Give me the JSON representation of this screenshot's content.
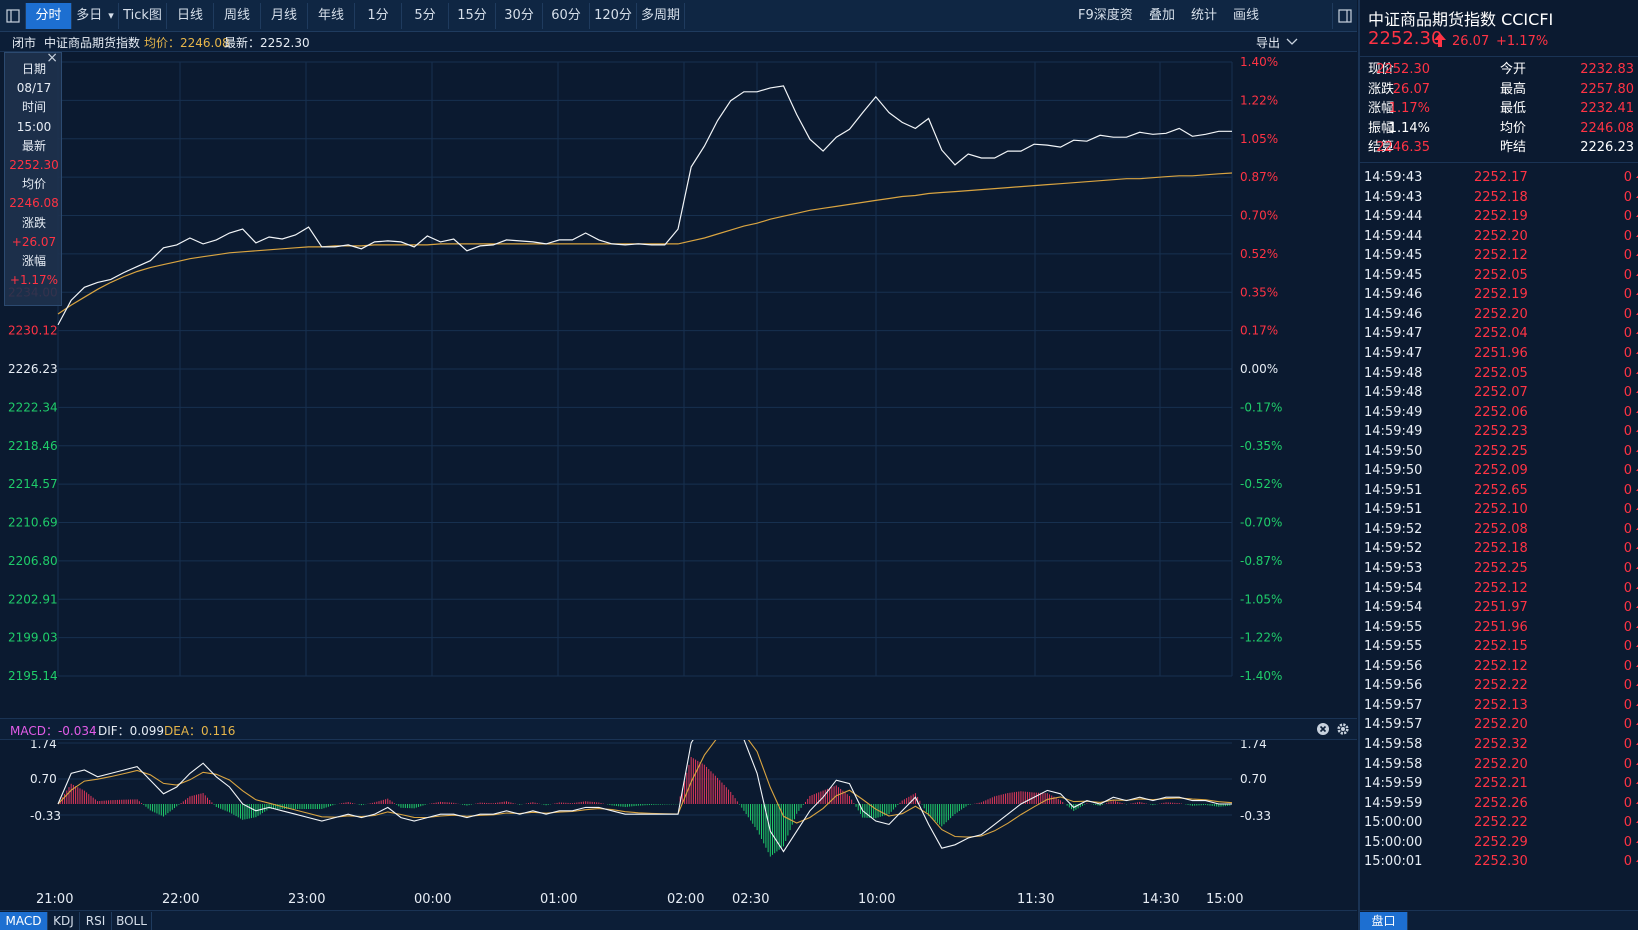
{
  "toolbar": {
    "tabs": [
      "分时",
      "多日",
      "Tick图",
      "日线",
      "周线",
      "月线",
      "年线",
      "1分",
      "5分",
      "15分",
      "30分",
      "60分",
      "120分",
      "多周期"
    ],
    "right": [
      "F9深度资料",
      "叠加",
      "统计",
      "画线"
    ],
    "dropdown_icon": "caret-down-icon"
  },
  "infobar": {
    "status": "闭市",
    "name": "中证商品期货指数",
    "avg_label": "均价：2246.08",
    "last_label": "最新：2252.30",
    "export": "导出"
  },
  "tooltip": {
    "rows": [
      "日期",
      "08/17",
      "时间",
      "15:00",
      "最新",
      "2252.30",
      "均价",
      "2246.08",
      "涨跌",
      "+26.07",
      "涨幅",
      "+1.17%"
    ]
  },
  "axis": {
    "left_prices": [
      "2234.00",
      "2230.12",
      "2226.23",
      "2222.34",
      "2218.46",
      "2214.57",
      "2210.69",
      "2206.80",
      "2202.91",
      "2199.03",
      "2195.14"
    ],
    "right_pcts": [
      "1.40%",
      "1.22%",
      "1.05%",
      "0.87%",
      "0.70%",
      "0.52%",
      "0.35%",
      "0.17%",
      "0.00%",
      "-0.17%",
      "-0.35%",
      "-0.52%",
      "-0.70%",
      "-0.87%",
      "-1.05%",
      "-1.22%",
      "-1.40%"
    ],
    "macd_ticks": [
      "1.74",
      "0.70",
      "-0.33"
    ],
    "time_labels": [
      "21:00",
      "22:00",
      "23:00",
      "00:00",
      "01:00",
      "02:00",
      "02:30",
      "10:00",
      "11:30",
      "14:30",
      "15:00"
    ]
  },
  "macd_bar": {
    "macd": "MACD：-0.034",
    "dif": "DIF：0.099",
    "dea": "DEA：0.116"
  },
  "bottom_tabs": [
    "MACD",
    "KDJ",
    "RSI",
    "BOLL"
  ],
  "quote": {
    "title": "中证商品期货指数 CCICFI",
    "price": "2252.30",
    "change": "26.07",
    "change_pct": "+1.17%",
    "fields": [
      {
        "l": "现价",
        "v": "2252.30",
        "l2": "今开",
        "v2": "2232.83"
      },
      {
        "l": "涨跌",
        "v": "26.07",
        "l2": "最高",
        "v2": "2257.80"
      },
      {
        "l": "涨幅",
        "v": "1.17%",
        "l2": "最低",
        "v2": "2232.41"
      },
      {
        "l": "振幅",
        "v": "1.14%",
        "l2": "均价",
        "v2": "2246.08"
      },
      {
        "l": "结算",
        "v": "2246.35",
        "l2": "昨结",
        "v2": "2226.23"
      }
    ]
  },
  "ticks": [
    [
      "14:59:43",
      "2252.17",
      "0"
    ],
    [
      "14:59:43",
      "2252.18",
      "0"
    ],
    [
      "14:59:44",
      "2252.19",
      "0"
    ],
    [
      "14:59:44",
      "2252.20",
      "0"
    ],
    [
      "14:59:45",
      "2252.12",
      "0"
    ],
    [
      "14:59:45",
      "2252.05",
      "0"
    ],
    [
      "14:59:46",
      "2252.19",
      "0"
    ],
    [
      "14:59:46",
      "2252.20",
      "0"
    ],
    [
      "14:59:47",
      "2252.04",
      "0"
    ],
    [
      "14:59:47",
      "2251.96",
      "0"
    ],
    [
      "14:59:48",
      "2252.05",
      "0"
    ],
    [
      "14:59:48",
      "2252.07",
      "0"
    ],
    [
      "14:59:49",
      "2252.06",
      "0"
    ],
    [
      "14:59:49",
      "2252.23",
      "0"
    ],
    [
      "14:59:50",
      "2252.25",
      "0"
    ],
    [
      "14:59:50",
      "2252.09",
      "0"
    ],
    [
      "14:59:51",
      "2252.65",
      "0"
    ],
    [
      "14:59:51",
      "2252.10",
      "0"
    ],
    [
      "14:59:52",
      "2252.08",
      "0"
    ],
    [
      "14:59:52",
      "2252.18",
      "0"
    ],
    [
      "14:59:53",
      "2252.25",
      "0"
    ],
    [
      "14:59:54",
      "2252.12",
      "0"
    ],
    [
      "14:59:54",
      "2251.97",
      "0"
    ],
    [
      "14:59:55",
      "2251.96",
      "0"
    ],
    [
      "14:59:55",
      "2252.15",
      "0"
    ],
    [
      "14:59:56",
      "2252.12",
      "0"
    ],
    [
      "14:59:56",
      "2252.22",
      "0"
    ],
    [
      "14:59:57",
      "2252.13",
      "0"
    ],
    [
      "14:59:57",
      "2252.20",
      "0"
    ],
    [
      "14:59:58",
      "2252.32",
      "0"
    ],
    [
      "14:59:58",
      "2252.20",
      "0"
    ],
    [
      "14:59:59",
      "2252.21",
      "0"
    ],
    [
      "14:59:59",
      "2252.26",
      "0"
    ],
    [
      "15:00:00",
      "2252.22",
      "0"
    ],
    [
      "15:00:00",
      "2252.29",
      "0"
    ],
    [
      "15:00:01",
      "2252.30",
      "0"
    ]
  ],
  "panel_tab": "盘口",
  "chart_data": {
    "type": "line",
    "series": [
      {
        "values": [
          2230.7,
          2233.2,
          2234.5,
          2235.0,
          2235.3,
          2236.0,
          2236.6,
          2237.2,
          2238.5,
          2238.8,
          2239.5,
          2238.9,
          2239.3,
          2240.0,
          2240.4,
          2239.0,
          2239.6,
          2239.4,
          2239.8,
          2240.6,
          2238.6,
          2238.6,
          2238.8,
          2238.4,
          2239.1,
          2239.2,
          2239.1,
          2238.6,
          2239.7,
          2239.1,
          2239.4,
          2238.2,
          2238.7,
          2238.8,
          2239.3,
          2239.2,
          2239.1,
          2238.9,
          2239.3,
          2239.3,
          2240.0,
          2239.3,
          2238.9,
          2238.8,
          2238.9,
          2238.8,
          2238.8,
          2240.4,
          2246.7,
          2248.8,
          2251.4,
          2253.4,
          2254.3,
          2254.3,
          2254.7,
          2254.9,
          2252.0,
          2249.5,
          2248.3,
          2249.7,
          2250.5,
          2252.2,
          2253.8,
          2252.2,
          2251.2,
          2250.6,
          2251.6,
          2248.4,
          2246.9,
          2248.0,
          2247.6,
          2247.6,
          2248.3,
          2248.3,
          2249.0,
          2248.9,
          2248.7,
          2249.4,
          2249.3,
          2249.9,
          2249.7,
          2249.7,
          2250.2,
          2250.0,
          2250.1,
          2250.6,
          2249.8,
          2250.0,
          2250.3,
          2250.3
        ]
      },
      {
        "values": [
          2231.8,
          2232.7,
          2233.5,
          2234.3,
          2235.0,
          2235.6,
          2236.1,
          2236.5,
          2236.8,
          2237.1,
          2237.4,
          2237.6,
          2237.8,
          2238.0,
          2238.1,
          2238.2,
          2238.3,
          2238.4,
          2238.5,
          2238.6,
          2238.6,
          2238.7,
          2238.7,
          2238.7,
          2238.8,
          2238.8,
          2238.8,
          2238.8,
          2238.8,
          2238.9,
          2238.9,
          2238.9,
          2238.9,
          2238.9,
          2238.9,
          2238.9,
          2238.9,
          2238.9,
          2238.9,
          2238.9,
          2238.9,
          2238.9,
          2238.9,
          2238.9,
          2238.9,
          2238.9,
          2238.9,
          2238.9,
          2239.2,
          2239.5,
          2239.9,
          2240.3,
          2240.7,
          2241.0,
          2241.4,
          2241.7,
          2242.0,
          2242.3,
          2242.5,
          2242.7,
          2242.9,
          2243.1,
          2243.3,
          2243.5,
          2243.7,
          2243.8,
          2244.0,
          2244.1,
          2244.2,
          2244.3,
          2244.4,
          2244.5,
          2244.6,
          2244.7,
          2244.8,
          2244.9,
          2245.0,
          2245.1,
          2245.2,
          2245.3,
          2245.4,
          2245.5,
          2245.5,
          2245.6,
          2245.7,
          2245.8,
          2245.8,
          2245.9,
          2246.0,
          2246.08
        ]
      }
    ],
    "ylim": [
      2195.14,
      2257.32
    ],
    "macd": {
      "dif": [
        0.0,
        0.9,
        1.0,
        0.8,
        0.9,
        1.0,
        1.1,
        0.7,
        0.3,
        0.5,
        0.9,
        1.2,
        0.8,
        0.5,
        0.0,
        -0.2,
        -0.1,
        -0.2,
        -0.3,
        -0.4,
        -0.5,
        -0.4,
        -0.3,
        -0.4,
        -0.3,
        -0.1,
        -0.4,
        -0.5,
        -0.4,
        -0.3,
        -0.3,
        -0.4,
        -0.3,
        -0.3,
        -0.2,
        -0.3,
        -0.2,
        -0.3,
        -0.2,
        -0.2,
        -0.1,
        -0.1,
        -0.2,
        -0.3,
        -0.3,
        -0.3,
        -0.3,
        -0.3,
        1.8,
        2.4,
        2.6,
        2.5,
        1.9,
        0.9,
        -0.8,
        -1.4,
        -0.8,
        -0.2,
        0.2,
        0.7,
        0.6,
        -0.2,
        -0.5,
        -0.6,
        -0.2,
        0.2,
        -0.6,
        -1.3,
        -1.2,
        -1.0,
        -0.9,
        -0.6,
        -0.3,
        0.0,
        0.2,
        0.4,
        0.3,
        -0.1,
        0.1,
        0.0,
        0.2,
        0.1,
        0.2,
        0.1,
        0.2,
        0.2,
        0.1,
        0.1,
        0.0,
        0.0
      ]
    },
    "xlabel": "",
    "ylabel": ""
  }
}
